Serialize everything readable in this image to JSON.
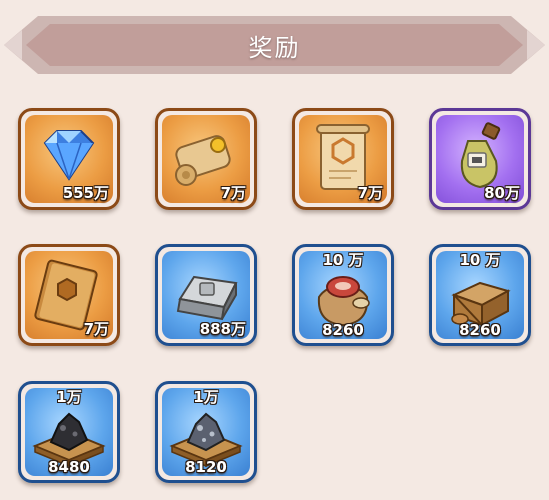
{
  "header": {
    "title": "奖励"
  },
  "colors": {
    "orange": "#ec9d44",
    "purple": "#a370f0",
    "blue": "#5ea6ec",
    "background": "#f4e9e3"
  },
  "rewards": [
    {
      "icon": "diamond-icon",
      "rarity": "orange",
      "quantity": "555万"
    },
    {
      "icon": "scroll-icon",
      "rarity": "orange",
      "quantity": "7万"
    },
    {
      "icon": "parchment-icon",
      "rarity": "orange",
      "quantity": "7万"
    },
    {
      "icon": "potion-icon",
      "rarity": "purple",
      "quantity": "80万"
    },
    {
      "icon": "book-icon",
      "rarity": "orange",
      "quantity": "7万"
    },
    {
      "icon": "iron-ingot-icon",
      "rarity": "blue",
      "quantity": "888万"
    },
    {
      "icon": "meat-sack-icon",
      "rarity": "blue",
      "top_quantity": "10 万",
      "quantity": "8260"
    },
    {
      "icon": "wood-crate-icon",
      "rarity": "blue",
      "top_quantity": "10 万",
      "quantity": "8260"
    },
    {
      "icon": "coal-pallet-icon",
      "rarity": "blue",
      "top_quantity": "1万",
      "quantity": "8480"
    },
    {
      "icon": "ore-pallet-icon",
      "rarity": "blue",
      "top_quantity": "1万",
      "quantity": "8120"
    }
  ]
}
